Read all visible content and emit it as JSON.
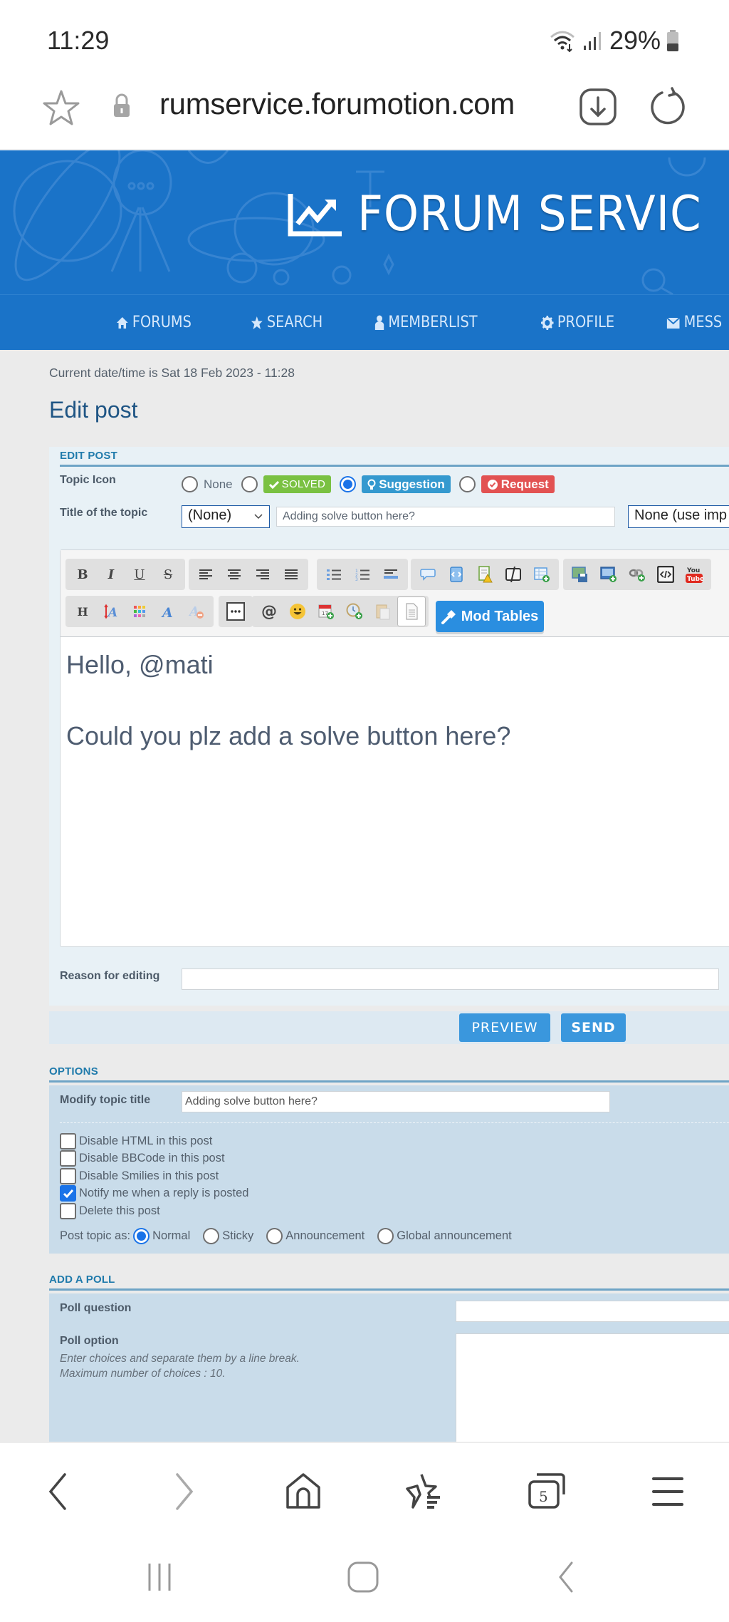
{
  "status_bar": {
    "time": "11:29",
    "battery_percent": "29%",
    "battery_level": 0.29,
    "icons": [
      "wifi-icon",
      "signal-icon",
      "battery-icon"
    ]
  },
  "browser": {
    "url": "rumservice.forumotion.com",
    "icons": [
      "bookmark-star-icon",
      "lock-icon",
      "download-icon",
      "reload-icon"
    ],
    "bottom_bar": {
      "tab_count": "5",
      "icons": [
        "back-icon",
        "forward-icon",
        "home-icon",
        "bookmarks-icon",
        "tabs-icon",
        "menu-icon"
      ]
    }
  },
  "android_nav": {
    "icons": [
      "recents-icon",
      "home-nav-icon",
      "back-nav-icon"
    ]
  },
  "forum": {
    "logo_text": "FORUM SERVIC",
    "brand_color": "#1a73c8",
    "nav": [
      {
        "label": "FORUMS",
        "icon": "home-icon"
      },
      {
        "label": "SEARCH",
        "icon": "star-icon"
      },
      {
        "label": "MEMBERLIST",
        "icon": "user-icon"
      },
      {
        "label": "PROFILE",
        "icon": "gear-icon"
      },
      {
        "label": "MESS",
        "icon": "envelope-icon"
      }
    ]
  },
  "page": {
    "datetime": "Current date/time is Sat 18 Feb 2023 - 11:28",
    "title": "Edit post"
  },
  "edit_post": {
    "section_title": "EDIT POST",
    "topic_icon_label": "Topic Icon",
    "topic_icons": [
      {
        "label": "None",
        "selected": false,
        "badge": false
      },
      {
        "label": "SOLVED",
        "selected": false,
        "badge": true,
        "color": "#7ac142"
      },
      {
        "label": "Suggestion",
        "selected": true,
        "badge": true,
        "color": "#3499cf"
      },
      {
        "label": "Request",
        "selected": false,
        "badge": true,
        "color": "#e25252"
      }
    ],
    "title_label": "Title of the topic",
    "prefix_select": "(None)",
    "title_value": "Adding solve button here?",
    "second_select": "None (use imp",
    "toolbar": {
      "row1_groups": [
        [
          "bold",
          "italic",
          "underline",
          "strike"
        ],
        [
          "align-left",
          "align-center",
          "align-right",
          "justify"
        ],
        [
          "bullet-list",
          "numbered-list",
          "horizontal-rule"
        ],
        [
          "quote",
          "code",
          "spoiler",
          "hide",
          "table"
        ],
        [
          "image-upload",
          "image",
          "link",
          "embed-code",
          "youtube"
        ]
      ],
      "row2_groups": [
        [
          "heading",
          "font-size",
          "color",
          "font-face",
          "remove-format"
        ],
        [
          "more"
        ],
        [
          "mention",
          "smilies",
          "date",
          "time",
          "paste",
          "source"
        ]
      ],
      "mod_tables_label": "Mod Tables"
    },
    "body_lines": [
      "Hello, @mati",
      "",
      "Could you plz add a solve button here?"
    ],
    "reason_label": "Reason for editing",
    "reason_value": "",
    "preview_label": "PREVIEW",
    "send_label": "SEND"
  },
  "options": {
    "section_title": "OPTIONS",
    "modify_title_label": "Modify topic title",
    "modify_title_value": "Adding solve button here?",
    "checkboxes": [
      {
        "label": "Disable HTML in this post",
        "checked": false
      },
      {
        "label": "Disable BBCode in this post",
        "checked": false
      },
      {
        "label": "Disable Smilies in this post",
        "checked": false
      },
      {
        "label": "Notify me when a reply is posted",
        "checked": true
      },
      {
        "label": "Delete this post",
        "checked": false
      }
    ],
    "post_as_label": "Post topic as:",
    "post_as": [
      {
        "label": "Normal",
        "selected": true
      },
      {
        "label": "Sticky",
        "selected": false
      },
      {
        "label": "Announcement",
        "selected": false
      },
      {
        "label": "Global announcement",
        "selected": false
      }
    ]
  },
  "poll": {
    "section_title": "ADD A POLL",
    "question_label": "Poll question",
    "question_value": "",
    "option_label": "Poll option",
    "option_help_1": "Enter choices and separate them by a line break.",
    "option_help_2": "Maximum number of choices : 10."
  }
}
